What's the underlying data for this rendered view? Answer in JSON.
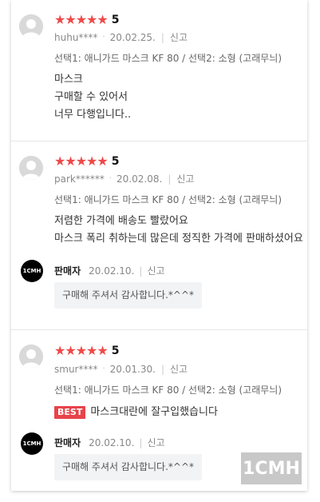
{
  "reviews": [
    {
      "rating": "5",
      "stars": "★★★★★",
      "user": "huhu****",
      "date": "20.02.25.",
      "report": "신고",
      "option": "선택1: 애니가드 마스크 KF 80 / 선택2: 소형 (고래무늬)",
      "lines": [
        "마스크",
        "구매할 수 있어서",
        "너무 다행입니다.."
      ]
    },
    {
      "rating": "5",
      "stars": "★★★★★",
      "user": "park******",
      "date": "20.02.08.",
      "report": "신고",
      "option": "선택1: 애니가드 마스크 KF 80 / 선택2: 소형 (고래무늬)",
      "lines": [
        "저렴한 가격에 배송도 빨랐어요",
        "마스크 폭리 취하는데 많은데 정직한 가격에 판매하셨어요"
      ],
      "reply": {
        "seller_logo": "1CMH",
        "seller_name": "판매자",
        "date": "20.02.10.",
        "report": "신고",
        "text": "구매해 주셔서 감사합니다.*^^*"
      }
    },
    {
      "rating": "5",
      "stars": "★★★★★",
      "user": "smur****",
      "date": "20.01.30.",
      "report": "신고",
      "option": "선택1: 애니가드 마스크 KF 80 / 선택2: 소형 (고래무늬)",
      "best_badge": "BEST",
      "lines": [
        "마스크대란에 잘구입했습니다"
      ],
      "reply": {
        "seller_logo": "1CMH",
        "seller_name": "판매자",
        "date": "20.02.10.",
        "report": "신고",
        "text": "구매해 주셔서 감사합니다.*^^*"
      }
    }
  ],
  "watermark": "1CMH",
  "colors": {
    "star": "#f04848",
    "best": "#e8434a",
    "reply_bg": "#f2f3f5"
  }
}
